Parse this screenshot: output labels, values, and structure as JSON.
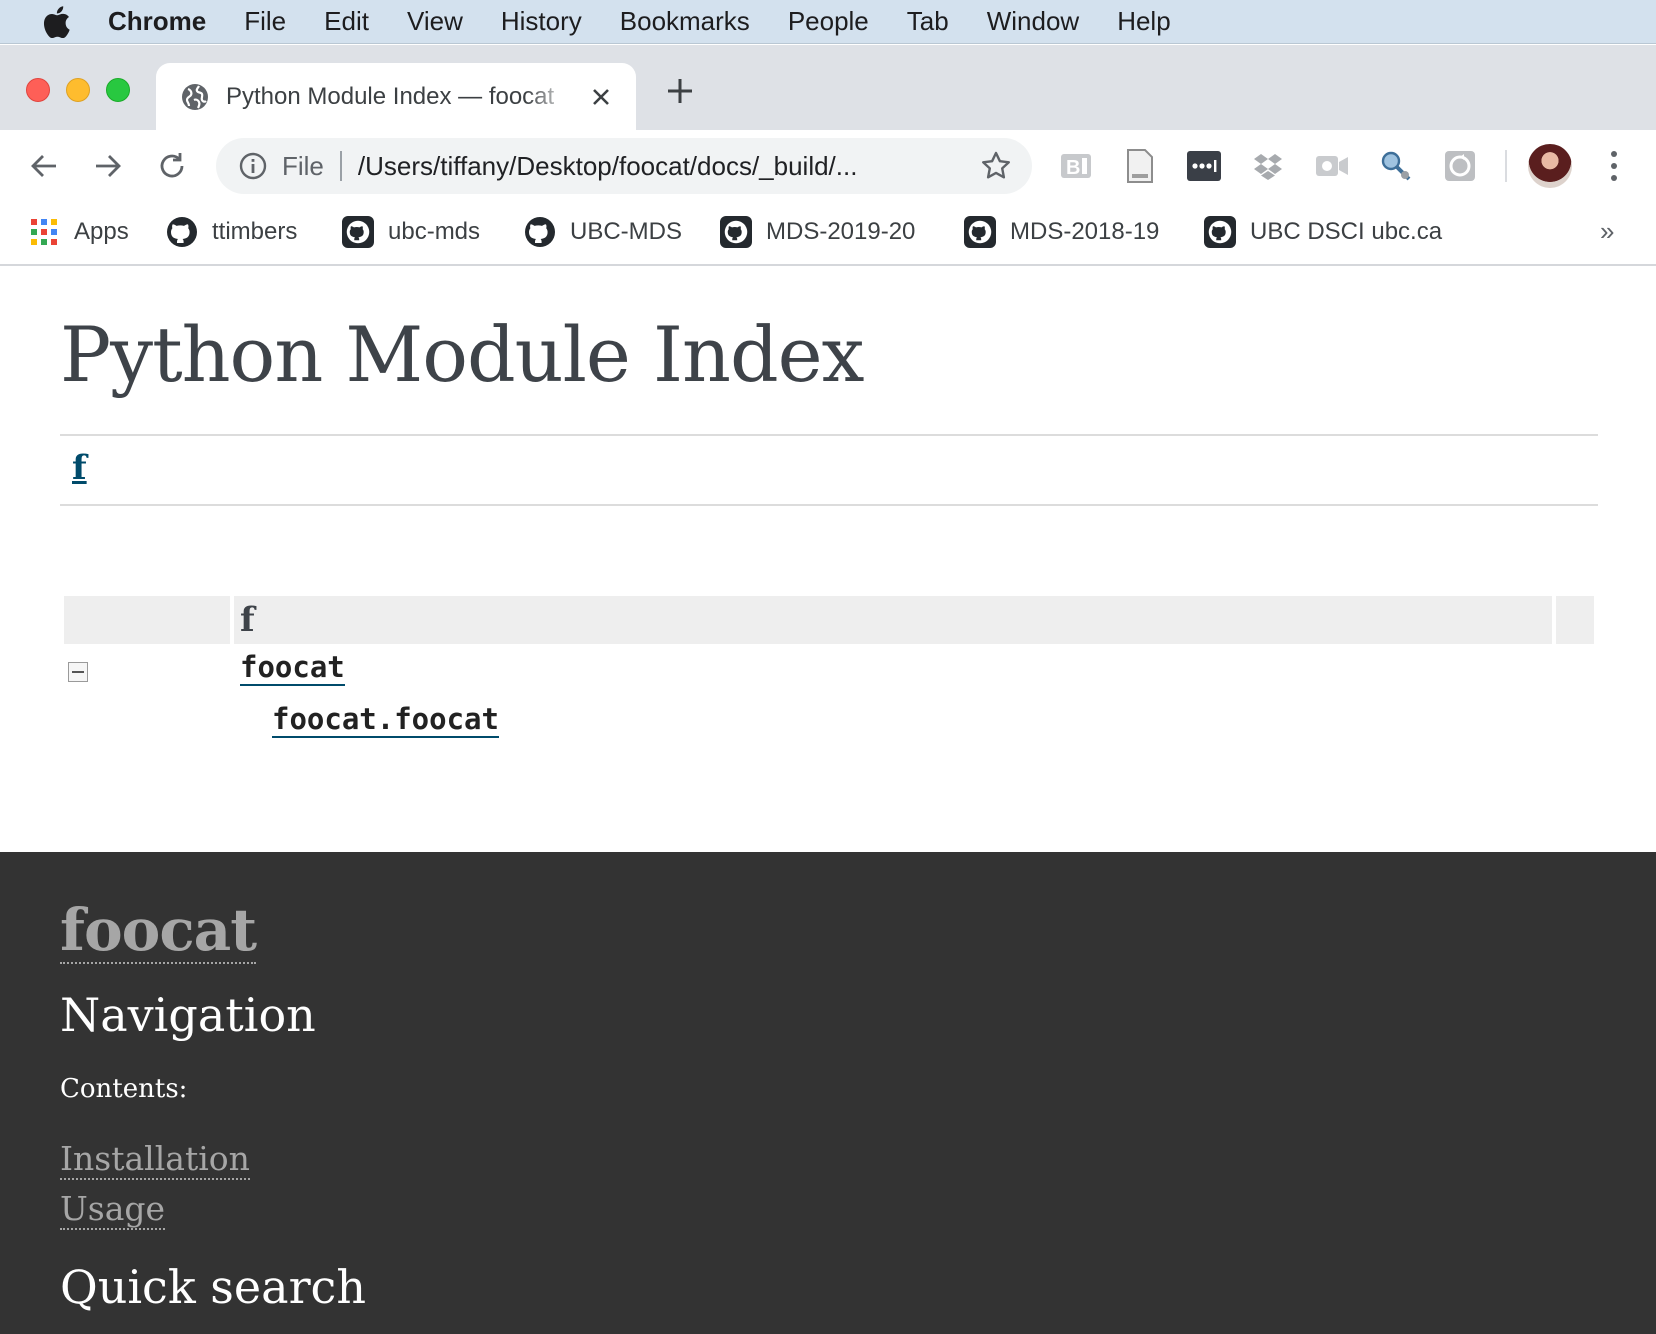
{
  "menubar": {
    "app_name": "Chrome",
    "items": [
      "File",
      "Edit",
      "View",
      "History",
      "Bookmarks",
      "People",
      "Tab",
      "Window",
      "Help"
    ]
  },
  "tab": {
    "title": "Python Module Index — foocat"
  },
  "omnibox": {
    "scheme": "File",
    "url": "/Users/tiffany/Desktop/foocat/docs/_build/..."
  },
  "extensions": [
    "bold-b-icon",
    "document-icon",
    "password-manager-icon",
    "dropbox-icon",
    "video-icon",
    "magnifier-icon",
    "sync-icon"
  ],
  "bookmarks": {
    "items": [
      {
        "label": "Apps",
        "icon": "apps-grid-icon"
      },
      {
        "label": "ttimbers",
        "icon": "github-icon"
      },
      {
        "label": "ubc-mds",
        "icon": "github-org-icon"
      },
      {
        "label": "UBC-MDS",
        "icon": "github-icon"
      },
      {
        "label": "MDS-2019-20",
        "icon": "github-org-icon"
      },
      {
        "label": "MDS-2018-19",
        "icon": "github-org-icon"
      },
      {
        "label": "UBC DSCI ubc.ca",
        "icon": "github-org-icon"
      }
    ],
    "more": "»"
  },
  "page": {
    "title": "Python Module Index",
    "letter_link": "f",
    "section_letter": "f",
    "modules": [
      "foocat",
      "foocat.foocat"
    ]
  },
  "sidebar": {
    "logo": "foocat",
    "nav_heading": "Navigation",
    "contents_caption": "Contents:",
    "links": [
      "Installation",
      "Usage"
    ],
    "search_heading": "Quick search"
  },
  "colors": {
    "menubar_bg": "#d3e1ee",
    "tabstrip_bg": "#dee1e6",
    "link_color": "#004b6b",
    "sidebar_bg": "#333333",
    "sidebar_link": "#a6a6a6"
  }
}
